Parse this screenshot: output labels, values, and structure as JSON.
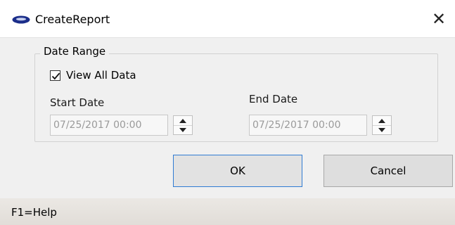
{
  "window": {
    "title": "CreateReport",
    "close_glyph": "✕"
  },
  "group": {
    "label": "Date Range",
    "view_all": {
      "label": "View All Data",
      "checked": true
    },
    "start_date": {
      "label": "Start Date",
      "value": "07/25/2017 00:00"
    },
    "end_date": {
      "label": "End Date",
      "value": "07/25/2017 00:00"
    }
  },
  "buttons": {
    "ok_label": "OK",
    "cancel_label": "Cancel"
  },
  "statusbar": {
    "text": "F1=Help"
  },
  "icons": {
    "app": "app-logo-icon",
    "close": "close-icon",
    "check": "checkmark-icon",
    "spin_up": "spin-up-icon",
    "spin_down": "spin-down-icon"
  },
  "colors": {
    "ok_border": "#2f7bd3",
    "app_icon": "#1b2e8a"
  }
}
